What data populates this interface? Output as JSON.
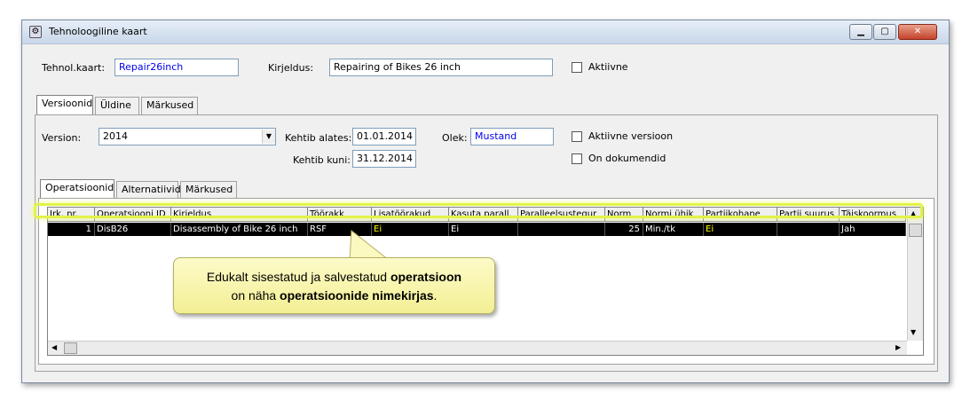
{
  "window": {
    "title": "Tehnoloogiline kaart"
  },
  "header": {
    "tehnol_kaart_label": "Tehnol.kaart:",
    "tehnol_kaart_value": "Repair26inch",
    "kirjeldus_label": "Kirjeldus:",
    "kirjeldus_value": "Repairing of Bikes 26 inch",
    "aktiivne_label": "Aktiivne"
  },
  "main_tabs": [
    "Versioonid",
    "Üldine",
    "Märkused"
  ],
  "version": {
    "version_label": "Version:",
    "version_value": "2014",
    "kehtib_alates_label": "Kehtib alates:",
    "kehtib_alates_value": "01.01.2014",
    "kehtib_kuni_label": "Kehtib kuni:",
    "kehtib_kuni_value": "31.12.2014",
    "olek_label": "Olek:",
    "olek_value": "Mustand",
    "aktiivne_versioon_label": "Aktiivne versioon",
    "on_dokumendid_label": "On dokumendid"
  },
  "sub_tabs": [
    "Operatsioonid",
    "Alternatiivid",
    "Märkused"
  ],
  "grid": {
    "columns": [
      "Jrk. nr.",
      "Operatsiooni ID",
      "Kirjeldus",
      "Töörakk",
      "Lisatöörakud",
      "Kasuta parall.",
      "Paralleelsustegur",
      "Norm",
      "Normi ühik",
      "Partiikohane",
      "Partii suurus",
      "Täiskoormus"
    ],
    "rows": [
      [
        "1",
        "DisB26",
        "Disassembly of Bike 26 inch",
        "RSF",
        "Ei",
        "Ei",
        "",
        "25",
        "Min./tk",
        "Ei",
        "",
        "Jah"
      ]
    ]
  },
  "callout": {
    "part1": "Edukalt sisestatud ja salvestatud ",
    "bold1": "operatsioon",
    "part2": "on näha ",
    "bold2": "operatsioonide nimekirjas",
    "part3": "."
  },
  "colors": {
    "selected_row_bg": "#000000",
    "ei_text": "#ffff00",
    "highlight": "#e2f24a",
    "callout_bg": "#f8f5b0"
  }
}
